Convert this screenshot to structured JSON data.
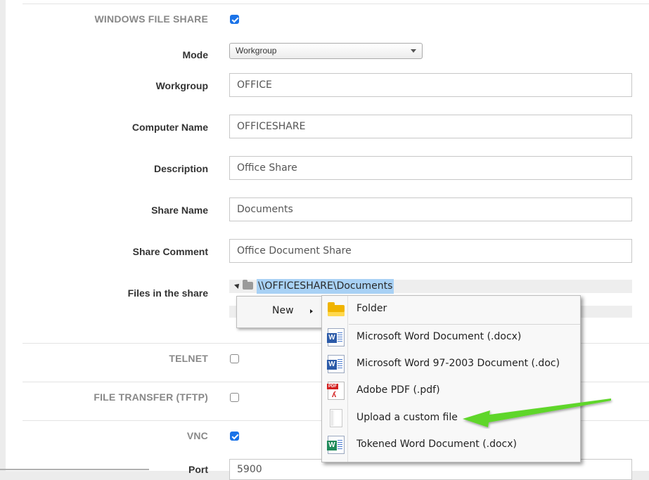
{
  "sections": {
    "windows_file_share": {
      "label": "WINDOWS FILE SHARE",
      "checked": true
    },
    "telnet": {
      "label": "TELNET",
      "checked": false
    },
    "tftp": {
      "label": "FILE TRANSFER (TFTP)",
      "checked": false
    },
    "vnc": {
      "label": "VNC",
      "checked": true
    }
  },
  "form": {
    "mode": {
      "label": "Mode",
      "value": "Workgroup"
    },
    "workgroup": {
      "label": "Workgroup",
      "value": "OFFICE"
    },
    "computer_name": {
      "label": "Computer Name",
      "value": "OFFICESHARE"
    },
    "description": {
      "label": "Description",
      "value": "Office Share"
    },
    "share_name": {
      "label": "Share Name",
      "value": "Documents"
    },
    "share_comment": {
      "label": "Share Comment",
      "value": "Office Document Share"
    },
    "files_in_share": {
      "label": "Files in the share",
      "root_path": "\\\\OFFICESHARE\\Documents"
    },
    "port": {
      "label": "Port",
      "value": "5900"
    }
  },
  "context_menu": {
    "new_label": "New",
    "submenu": [
      {
        "label": "Folder",
        "icon": "folder-icon"
      },
      {
        "label": "Microsoft Word Document (.docx)",
        "icon": "word-docx-icon"
      },
      {
        "label": "Microsoft Word 97-2003 Document (.doc)",
        "icon": "word-doc-icon"
      },
      {
        "label": "Adobe PDF (.pdf)",
        "icon": "pdf-icon"
      },
      {
        "label": "Upload a custom file",
        "icon": "blank-file-icon"
      },
      {
        "label": "Tokened Word Document (.docx)",
        "icon": "tokened-word-icon"
      }
    ]
  },
  "colors": {
    "checkbox_on": "#1a73e8",
    "selection": "#a8d1f5",
    "arrow": "#5fd629"
  }
}
